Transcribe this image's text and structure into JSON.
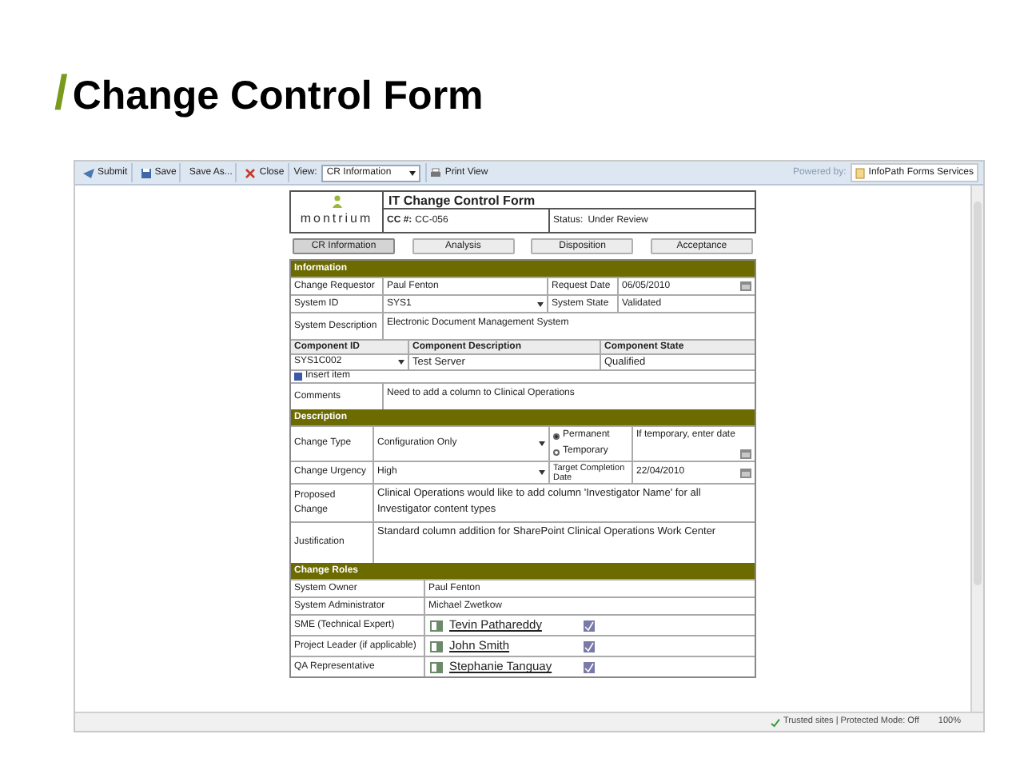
{
  "slide": {
    "slash": "/",
    "title": "Change Control Form"
  },
  "toolbar": {
    "buttons": [
      {
        "kind": "submit",
        "label": "Submit"
      },
      {
        "kind": "save",
        "label": "Save"
      },
      {
        "kind": "plain",
        "label": "Save As..."
      },
      {
        "kind": "close",
        "label": "Close"
      }
    ],
    "view_label": "View:",
    "view_value": "CR Information",
    "print_view": "Print View",
    "powered_by": "Powered by:",
    "services": "InfoPath Forms Services"
  },
  "form": {
    "logo": "montrium",
    "title": "IT Change Control Form",
    "cc_label": "CC #:",
    "cc_value": "CC-056",
    "status_label": "Status:",
    "status_value": "Under Review",
    "tabs": [
      {
        "label": "CR Information",
        "selected": true
      },
      {
        "label": "Analysis",
        "selected": false
      },
      {
        "label": "Disposition",
        "selected": false
      },
      {
        "label": "Acceptance",
        "selected": false
      }
    ],
    "information": {
      "heading": "Information",
      "requester_label": "Change Requestor",
      "requester": "Paul Fenton",
      "request_date_label": "Request Date",
      "request_date": "06/05/2010",
      "system_id_label": "System ID",
      "system_id": "SYS1",
      "system_state_label": "System State",
      "system_state": "Validated",
      "system_description_label": "System Description",
      "system_description": "Electronic Document Management System",
      "component_columns": [
        "Component ID",
        "Component Description",
        "Component State"
      ],
      "component_rows": [
        [
          "SYS1C002",
          "Test Server",
          "Qualified"
        ]
      ],
      "insert_item": "Insert item",
      "comments_label": "Comments",
      "comments": "Need to add a column to Clinical Operations"
    },
    "description": {
      "heading": "Description",
      "change_type_label": "Change Type",
      "change_type": "Configuration Only",
      "options": [
        {
          "label": "Permanent",
          "selected": true
        },
        {
          "label": "Temporary",
          "selected": false
        }
      ],
      "temporary_hint": "If temporary, enter date",
      "urgency_label": "Change Urgency",
      "urgency": "High",
      "target_label": "Target Completion Date",
      "target_date": "22/04/2010",
      "proposed_label": "Proposed Change",
      "proposed": "Clinical Operations would like to add column 'Investigator Name' for all Investigator content types",
      "justification_label": "Justification",
      "justification": "Standard column addition for SharePoint Clinical Operations Work Center"
    },
    "roles": {
      "heading": "Change Roles",
      "rows": [
        {
          "kind": "text",
          "label": "System Owner",
          "value": "Paul Fenton"
        },
        {
          "kind": "text",
          "label": "System Administrator",
          "value": "Michael Zwetkow"
        },
        {
          "kind": "person",
          "label": "SME (Technical Expert)",
          "value": "Tevin Pathareddy"
        },
        {
          "kind": "person",
          "label": "Project Leader (if applicable)",
          "value": "John Smith"
        },
        {
          "kind": "person",
          "label": "QA Representative",
          "value": "Stephanie Tanguay"
        }
      ]
    }
  },
  "status_bar": {
    "zone": "Trusted sites | Protected Mode: Off",
    "zoom": "100%"
  }
}
